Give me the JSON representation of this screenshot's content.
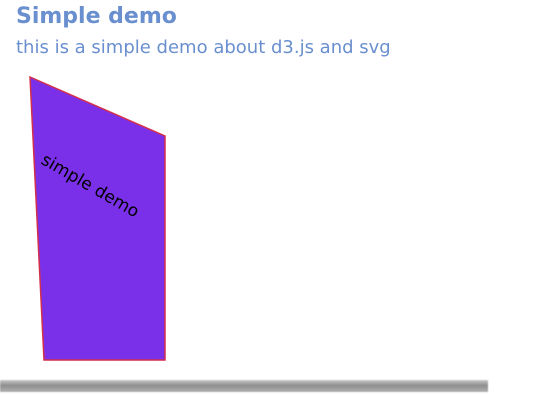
{
  "header": {
    "title": "Simple demo",
    "subtitle": "this is a simple demo about d3.js and svg"
  },
  "shape": {
    "label": "simple demo",
    "fill_color": "#7a30e8",
    "stroke_color": "#d42f4a",
    "label_color": "#000000"
  }
}
